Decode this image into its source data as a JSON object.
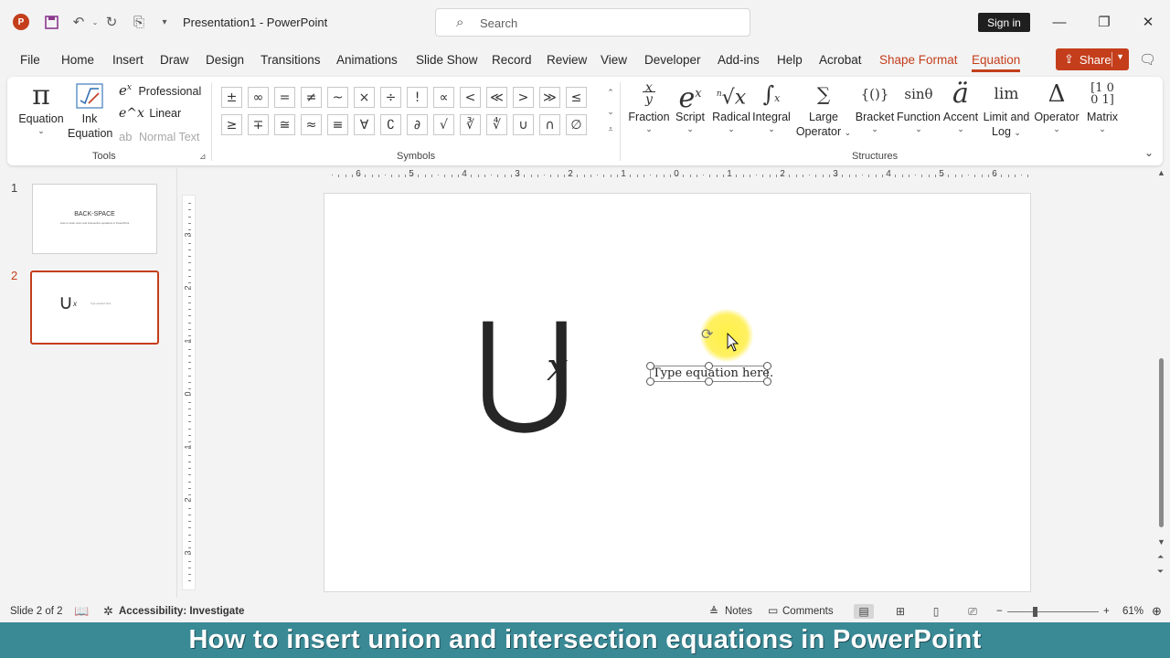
{
  "app": {
    "title": "Presentation1  -  PowerPoint",
    "search_placeholder": "Search",
    "sign_in": "Sign in",
    "share": "Share",
    "brand_color": "#c43e1c"
  },
  "menu": {
    "tabs": [
      "File",
      "Home",
      "Insert",
      "Draw",
      "Design",
      "Transitions",
      "Animations",
      "Slide Show",
      "Record",
      "Review",
      "View",
      "Developer",
      "Add-ins",
      "Help",
      "Acrobat",
      "Shape Format",
      "Equation"
    ],
    "active_tab": "Equation"
  },
  "ribbon": {
    "tools": {
      "label": "Tools",
      "equation": "Equation",
      "ink_equation_1": "Ink",
      "ink_equation_2": "Equation",
      "professional": "Professional",
      "linear": "Linear",
      "normal_text": "Normal Text"
    },
    "symbols": {
      "label": "Symbols",
      "row1": [
        "±",
        "∞",
        "=",
        "≠",
        "~",
        "×",
        "÷",
        "!",
        "∝",
        "<",
        "≪",
        ">",
        "≫",
        "≤"
      ],
      "row2": [
        "≥",
        "∓",
        "≅",
        "≈",
        "≡",
        "∀",
        "∁",
        "∂",
        "√",
        "∛",
        "∜",
        "∪",
        "∩",
        "∅"
      ]
    },
    "structures": {
      "label": "Structures",
      "items": [
        {
          "glyph": "x/y",
          "label": "Fraction",
          "label2": ""
        },
        {
          "glyph": "eˣ",
          "label": "Script",
          "label2": ""
        },
        {
          "glyph": "ⁿ√x",
          "label": "Radical",
          "label2": ""
        },
        {
          "glyph": "∫",
          "label": "Integral",
          "label2": ""
        },
        {
          "glyph": "∑",
          "label": "Large",
          "label2": "Operator"
        },
        {
          "glyph": "{()}",
          "label": "Bracket",
          "label2": ""
        },
        {
          "glyph": "sinθ",
          "label": "Function",
          "label2": ""
        },
        {
          "glyph": "ä",
          "label": "Accent",
          "label2": ""
        },
        {
          "glyph": "lim",
          "label": "Limit and",
          "label2": "Log"
        },
        {
          "glyph": "Δ",
          "label": "Operator",
          "label2": ""
        },
        {
          "glyph": "[10]",
          "label": "Matrix",
          "label2": ""
        }
      ]
    }
  },
  "slides": {
    "thumbs": [
      {
        "num": "1",
        "title": "BACK-SPACE",
        "subtitle": "How to insert union and intersection equations in PowerPoint"
      },
      {
        "num": "2",
        "glyph": "∪",
        "sup": "x",
        "hint": "Type equation here."
      }
    ],
    "active": 2
  },
  "ruler": {
    "h_numbers": [
      "6",
      "5",
      "4",
      "3",
      "2",
      "1",
      "0",
      "1",
      "2",
      "3",
      "4",
      "5",
      "6"
    ],
    "v_numbers": [
      "3",
      "2",
      "1",
      "0",
      "1",
      "2",
      "3"
    ]
  },
  "canvas": {
    "union_symbol": "⋃",
    "union_sub": "x",
    "equation_placeholder": "Type equation here."
  },
  "status": {
    "slide_info": "Slide 2 of 2",
    "accessibility": "Accessibility: Investigate",
    "notes": "Notes",
    "comments": "Comments",
    "zoom": "61%"
  },
  "banner": {
    "text": "How to insert union and intersection equations in PowerPoint",
    "color": "#3a8a96"
  }
}
